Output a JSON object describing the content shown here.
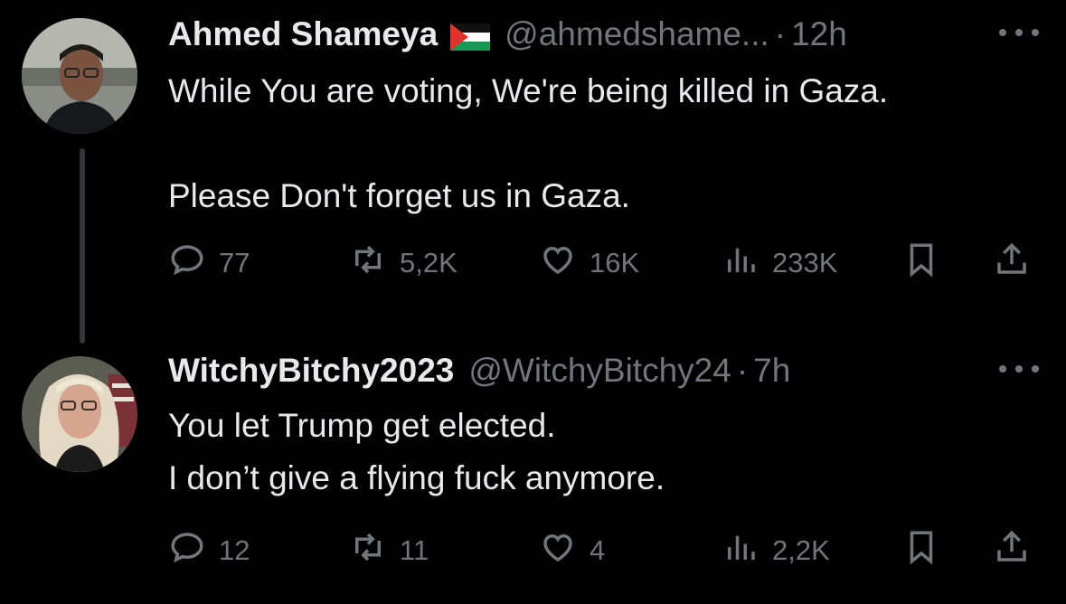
{
  "tweets": [
    {
      "name": "Ahmed Shameya",
      "flag": "palestine-flag",
      "handle": "@ahmedshame...",
      "time": "12h",
      "text": "While You are voting,  We're being killed in Gaza.\n\nPlease Don't forget us in Gaza.",
      "replies": "77",
      "retweets": "5,2K",
      "likes": "16K",
      "views": "233K"
    },
    {
      "name": "WitchyBitchy2023",
      "handle": "@WitchyBitchy24",
      "time": "7h",
      "text": "You let Trump get elected.\nI don’t give a flying fuck anymore.",
      "replies": "12",
      "retweets": "11",
      "likes": "4",
      "views": "2,2K"
    }
  ],
  "colors": {
    "background": "#000000",
    "text": "#e7e9ea",
    "muted": "#71767b",
    "thread_line": "#333639"
  },
  "icons": [
    "reply-icon",
    "retweet-icon",
    "like-icon",
    "views-icon",
    "bookmark-icon",
    "share-icon",
    "more-icon"
  ]
}
